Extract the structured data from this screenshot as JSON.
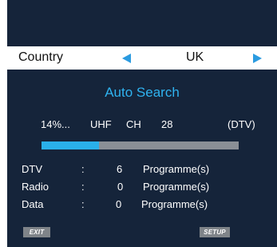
{
  "country": {
    "label": "Country",
    "value": "UK"
  },
  "title": "Auto Search",
  "status": {
    "percent_text": "14%...",
    "band": "UHF",
    "ch_label": "CH",
    "channel": "28",
    "type": "(DTV)"
  },
  "progress": {
    "fraction": 0.29
  },
  "results": [
    {
      "label": "DTV",
      "sep": ":",
      "count": "6",
      "unit": "Programme(s)"
    },
    {
      "label": "Radio",
      "sep": ":",
      "count": "0",
      "unit": "Programme(s)"
    },
    {
      "label": "Data",
      "sep": ":",
      "count": "0",
      "unit": "Programme(s)"
    }
  ],
  "buttons": {
    "exit": "EXIT",
    "setup": "SETUP"
  },
  "colors": {
    "background": "#15243a",
    "accent": "#2fb3f0",
    "progress_track": "#8a8f96"
  },
  "icons": {
    "prev": "arrow-left-icon",
    "next": "arrow-right-icon"
  }
}
